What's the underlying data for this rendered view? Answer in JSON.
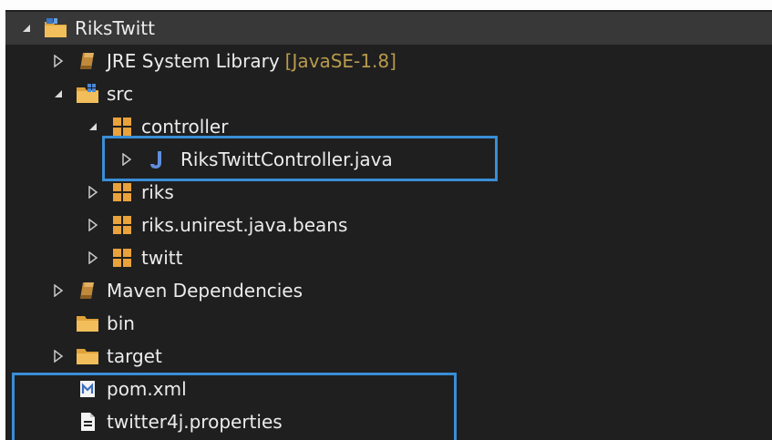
{
  "project": {
    "name": "RiksTwitt",
    "items": [
      {
        "label": "JRE System Library",
        "decoration": "[JavaSE-1.8]"
      },
      {
        "label": "src"
      },
      {
        "label": "controller"
      },
      {
        "label": "RiksTwittController.java"
      },
      {
        "label": "riks"
      },
      {
        "label": "riks.unirest.java.beans"
      },
      {
        "label": "twitt"
      },
      {
        "label": "Maven Dependencies"
      },
      {
        "label": "bin"
      },
      {
        "label": "target"
      },
      {
        "label": "pom.xml"
      },
      {
        "label": "twitter4j.properties"
      }
    ]
  },
  "icons": {
    "project": "project-folder-icon",
    "library": "library-jar-icon",
    "source_folder": "source-folder-icon",
    "package": "package-icon",
    "java_file": "java-file-icon",
    "folder": "folder-icon",
    "maven_file": "maven-file-icon",
    "text_file": "text-file-icon"
  },
  "colors": {
    "background": "#1f1f1f",
    "text": "#ececec",
    "decoration": "#b89a4d",
    "highlight_border": "#3a8ed6",
    "selected_row": "#383838"
  }
}
